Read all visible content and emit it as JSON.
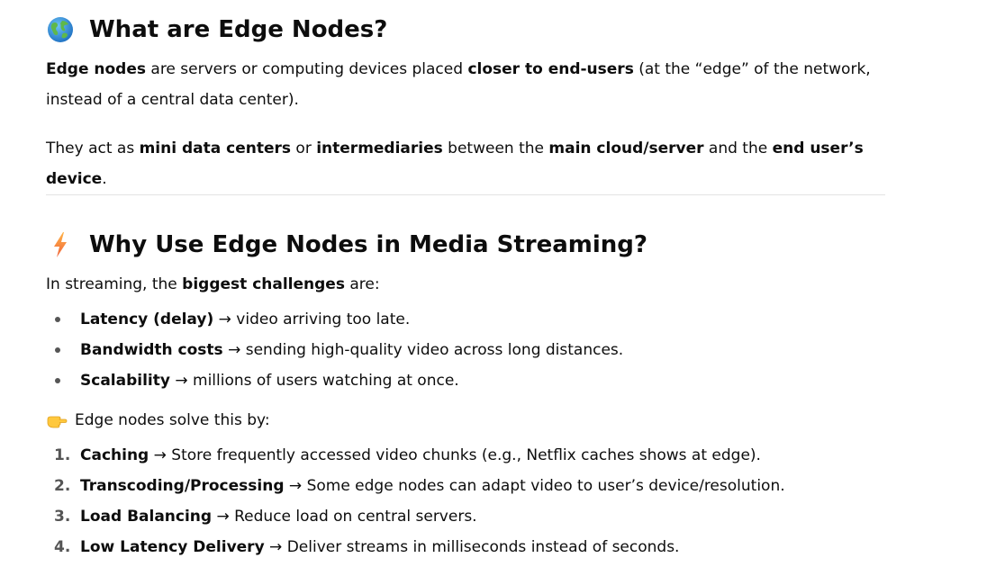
{
  "section1": {
    "title": "What are Edge Nodes?",
    "icon": "globe-icon",
    "p1": {
      "b1": "Edge nodes",
      "t1": " are servers or computing devices placed ",
      "b2": "closer to end-users",
      "t2": " (at the “edge” of the network, instead of a central data center)."
    },
    "p2": {
      "t1": "They act as ",
      "b1": "mini data centers",
      "t2": " or ",
      "b2": "intermediaries",
      "t3": " between the ",
      "b3": "main cloud/server",
      "t4": " and the ",
      "b4": "end user’s device",
      "t5": "."
    }
  },
  "section2": {
    "title": "Why Use Edge Nodes in Media Streaming?",
    "icon": "lightning-icon",
    "intro": {
      "t1": "In streaming, the ",
      "b1": "biggest challenges",
      "t2": " are:"
    },
    "challenges": [
      {
        "term": "Latency (delay)",
        "desc": " → video arriving too late."
      },
      {
        "term": "Bandwidth costs",
        "desc": " → sending high-quality video across long distances."
      },
      {
        "term": "Scalability",
        "desc": " → millions of users watching at once."
      }
    ],
    "solve_icon": "pointing-hand-icon",
    "solve_text": "Edge nodes solve this by:",
    "solutions": [
      {
        "num": "1.",
        "term": "Caching",
        "desc": " → Store frequently accessed video chunks (e.g., Netflix caches shows at edge)."
      },
      {
        "num": "2.",
        "term": "Transcoding/Processing",
        "desc": " → Some edge nodes can adapt video to user’s device/resolution."
      },
      {
        "num": "3.",
        "term": "Load Balancing",
        "desc": " → Reduce load on central servers."
      },
      {
        "num": "4.",
        "term": "Low Latency Delivery",
        "desc": " → Deliver streams in milliseconds instead of seconds."
      }
    ]
  },
  "colors": {
    "text": "#0d0d0d",
    "muted": "#555555",
    "divider": "#e3e3e3"
  }
}
